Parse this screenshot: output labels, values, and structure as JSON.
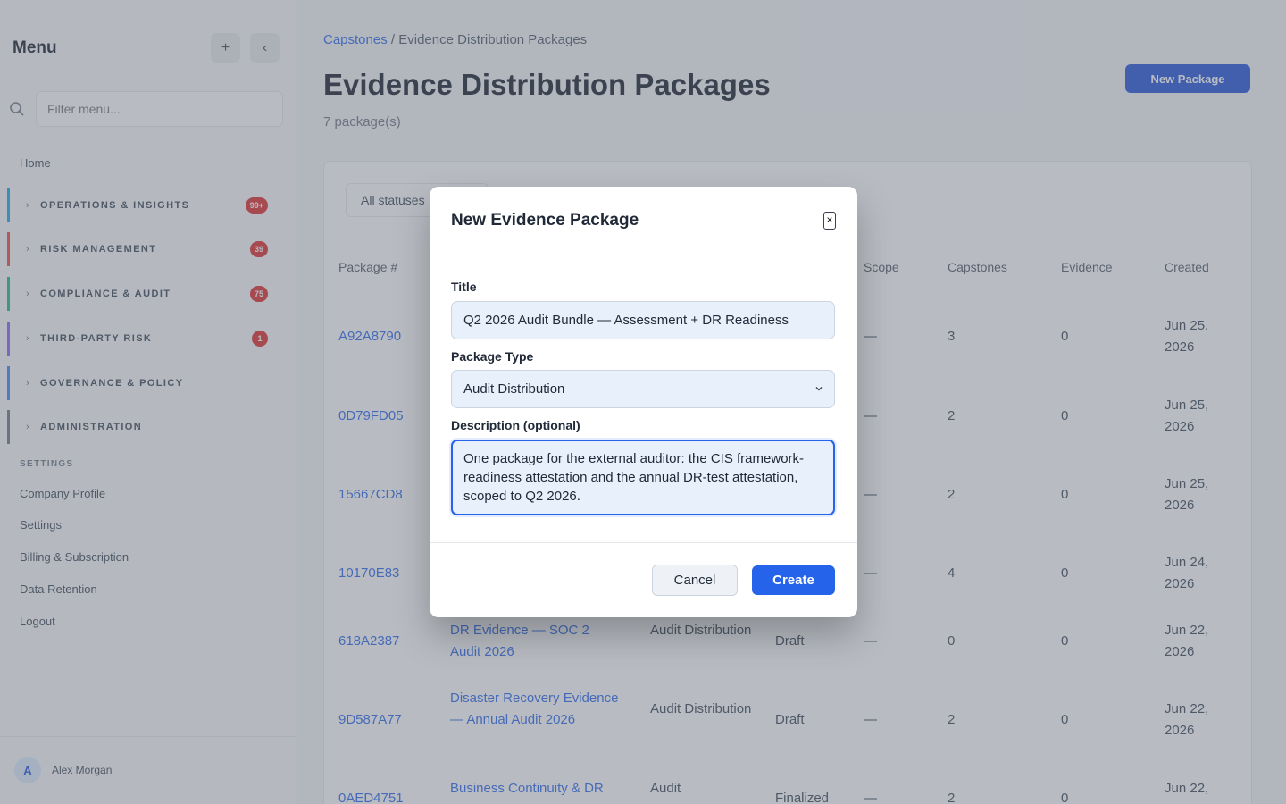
{
  "sidebar": {
    "title": "Menu",
    "add_icon": "plus-icon",
    "collapse_icon": "chevron-left-icon",
    "filter_placeholder": "Filter menu...",
    "home": "Home",
    "groups": [
      {
        "label": "OPERATIONS & INSIGHTS",
        "badge": "99+",
        "color": "#0ea5e9"
      },
      {
        "label": "RISK MANAGEMENT",
        "badge": "39",
        "color": "#ef4444"
      },
      {
        "label": "COMPLIANCE & AUDIT",
        "badge": "75",
        "color": "#10b981"
      },
      {
        "label": "THIRD-PARTY RISK",
        "badge": "1",
        "color": "#8b5cf6"
      },
      {
        "label": "GOVERNANCE & POLICY",
        "badge": "",
        "color": "#3b82f6"
      },
      {
        "label": "ADMINISTRATION",
        "badge": "",
        "color": "#6b7280"
      }
    ],
    "settings_heading": "SETTINGS",
    "settings_links": [
      "Company Profile",
      "Settings",
      "Billing & Subscription",
      "Data Retention",
      "Logout"
    ],
    "user": {
      "initial": "A",
      "name": "Alex Morgan"
    }
  },
  "header": {
    "breadcrumb_root": "Capstones",
    "breadcrumb_sep": "/",
    "breadcrumb_current": "Evidence Distribution Packages",
    "title": "Evidence Distribution Packages",
    "subtitle": "7 package(s)",
    "new_button": "New Package"
  },
  "table": {
    "filter_label": "All statuses",
    "columns": [
      "Package #",
      "Scope",
      "Capstones",
      "Evidence",
      "Created"
    ],
    "rows": [
      {
        "id": "A92A8790",
        "title": "",
        "type": "",
        "status": "",
        "scope": "—",
        "capstones": "3",
        "evidence": "0",
        "created": "Jun 25, 2026"
      },
      {
        "id": "0D79FD05",
        "title": "",
        "type": "",
        "status": "",
        "scope": "—",
        "capstones": "2",
        "evidence": "0",
        "created": "Jun 25, 2026"
      },
      {
        "id": "15667CD8",
        "title": "",
        "type": "",
        "status": "",
        "scope": "—",
        "capstones": "2",
        "evidence": "0",
        "created": "Jun 25, 2026"
      },
      {
        "id": "10170E83",
        "title": "",
        "type": "",
        "status": "",
        "scope": "—",
        "capstones": "4",
        "evidence": "0",
        "created": "Jun 24, 2026"
      },
      {
        "id": "618A2387",
        "title": "DR Evidence — SOC 2 Audit 2026",
        "type": "Audit Distribution",
        "status": "Draft",
        "scope": "—",
        "capstones": "0",
        "evidence": "0",
        "created": "Jun 22, 2026"
      },
      {
        "id": "9D587A77",
        "title": "Disaster Recovery Evidence — Annual Audit 2026",
        "type": "Audit Distribution",
        "status": "Draft",
        "scope": "—",
        "capstones": "2",
        "evidence": "0",
        "created": "Jun 22, 2026"
      },
      {
        "id": "0AED4751",
        "title": "Business Continuity & DR",
        "type": "Audit",
        "status": "Finalized",
        "scope": "—",
        "capstones": "2",
        "evidence": "0",
        "created": "Jun 22,"
      }
    ]
  },
  "modal": {
    "title": "New Evidence Package",
    "close_label": "×",
    "title_label": "Title",
    "title_value": "Q2 2026 Audit Bundle — Assessment + DR Readiness",
    "type_label": "Package Type",
    "type_value": "Audit Distribution",
    "description_label": "Description (optional)",
    "description_value": "One package for the external auditor: the CIS framework-readiness attestation and the annual DR-test attestation, scoped to Q2 2026.",
    "cancel_label": "Cancel",
    "create_label": "Create"
  }
}
